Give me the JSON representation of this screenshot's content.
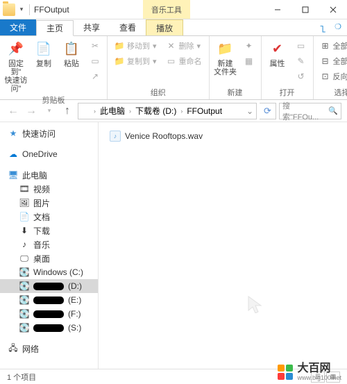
{
  "window": {
    "title": "FFOutput",
    "context_tab": "音乐工具"
  },
  "tabs": {
    "file": "文件",
    "home": "主页",
    "share": "共享",
    "view": "查看",
    "play": "播放"
  },
  "ribbon": {
    "clipboard": {
      "label": "剪贴板",
      "pin": "固定到\"\n快速访问\"",
      "copy": "复制",
      "paste": "粘贴"
    },
    "organize": {
      "label": "组织",
      "moveto": "移动到",
      "copyto": "复制到",
      "delete": "删除",
      "rename": "重命名"
    },
    "new": {
      "label": "新建",
      "newfolder": "新建\n文件夹"
    },
    "open": {
      "label": "打开",
      "properties": "属性"
    },
    "select": {
      "label": "选择",
      "selectall": "全部选择",
      "selectnone": "全部取消",
      "invert": "反向选择"
    }
  },
  "nav": {
    "crumbs": [
      "此电脑",
      "下载卷 (D:)",
      "FFOutput"
    ],
    "search_placeholder": "搜索\"FFOu..."
  },
  "tree": {
    "quick": "快速访问",
    "onedrive": "OneDrive",
    "thispc": "此电脑",
    "video": "视频",
    "pictures": "图片",
    "documents": "文档",
    "downloads": "下载",
    "music": "音乐",
    "desktop": "桌面",
    "drive_c": "Windows (C:)",
    "drive_d": "(D:)",
    "drive_e": "(E:)",
    "drive_f": "(F:)",
    "drive_s": "(S:)",
    "network": "网络"
  },
  "files": [
    {
      "name": "Venice Rooftops.wav"
    }
  ],
  "status": {
    "count": "1 个项目"
  },
  "watermark": {
    "brand": "大百网",
    "url": "www.big100.net"
  }
}
